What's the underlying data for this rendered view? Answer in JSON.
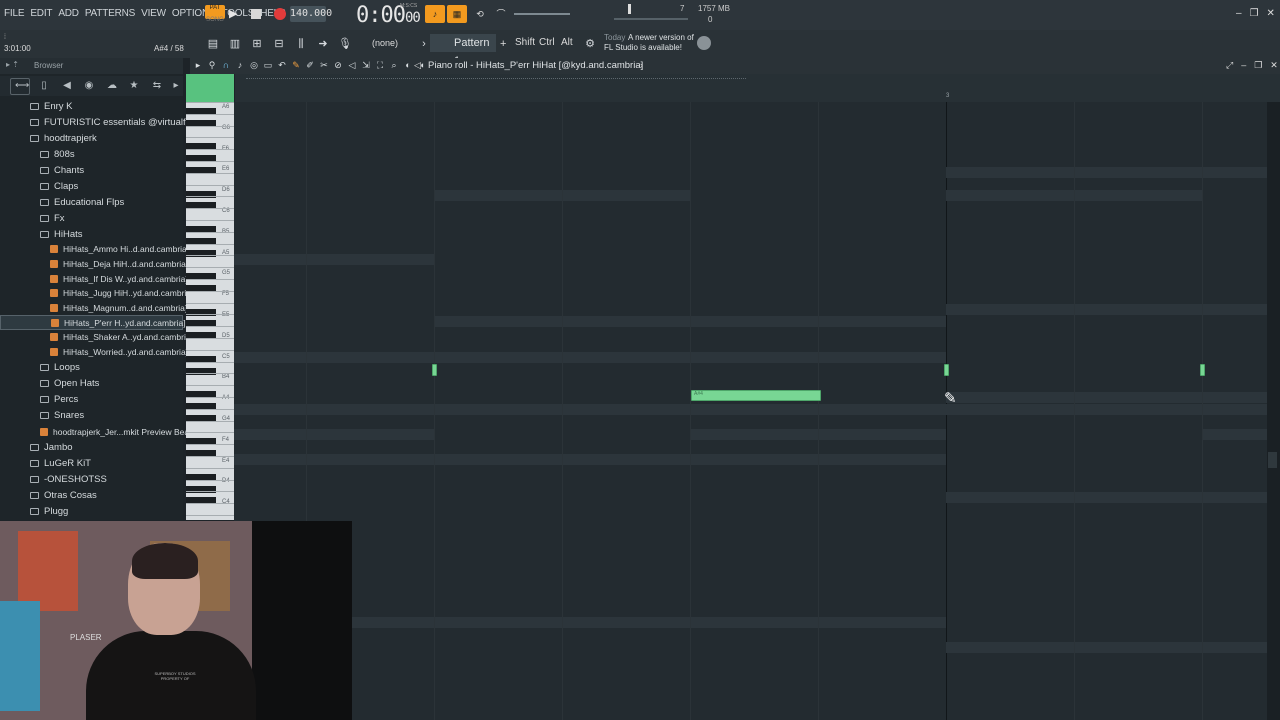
{
  "menu": [
    "FILE",
    "EDIT",
    "ADD",
    "PATTERNS",
    "VIEW",
    "OPTIONS",
    "TOOLS",
    "HELP"
  ],
  "transport": {
    "pat_label": "PAT",
    "song_label": "SONG",
    "tempo": "140.000",
    "time": "0:00",
    "time_sub": "00",
    "time_unit": "M:S:CS"
  },
  "monitor": {
    "cpu": "7",
    "memory": "1757 MB",
    "voices": "0"
  },
  "hint": {
    "line1": "3:01:00",
    "line2": "A#4 / 58"
  },
  "toolbar": {
    "none_label": "(none)",
    "pattern": "Pattern 1",
    "plus": "+",
    "shift": "Shift",
    "ctrl": "Ctrl",
    "alt": "Alt"
  },
  "news": {
    "date": "Today",
    "line1": "A newer version of",
    "line2": "FL Studio is available!"
  },
  "browser": {
    "title": "Browser",
    "items": [
      {
        "label": "Enry K",
        "type": "folder",
        "indent": 0
      },
      {
        "label": "FUTURISTIC essentials @virtualflavor",
        "type": "folder",
        "indent": 0
      },
      {
        "label": "hoodtrapjerk",
        "type": "folder",
        "indent": 0
      },
      {
        "label": "808s",
        "type": "folder",
        "indent": 1
      },
      {
        "label": "Chants",
        "type": "folder",
        "indent": 1
      },
      {
        "label": "Claps",
        "type": "folder",
        "indent": 1
      },
      {
        "label": "Educational Flps",
        "type": "folder",
        "indent": 1
      },
      {
        "label": "Fx",
        "type": "folder",
        "indent": 1
      },
      {
        "label": "HiHats",
        "type": "folder",
        "indent": 1
      },
      {
        "label": "HiHats_Ammo Hi..d.and.cambria]",
        "type": "file",
        "indent": 2
      },
      {
        "label": "HiHats_Deja HiH..d.and.cambria]",
        "type": "file",
        "indent": 2
      },
      {
        "label": "HiHats_If Dis W..yd.and.cambria]",
        "type": "file",
        "indent": 2
      },
      {
        "label": "HiHats_Jugg HiH..yd.and.cambria]",
        "type": "file",
        "indent": 2
      },
      {
        "label": "HiHats_Magnum..d.and.cambria]",
        "type": "file",
        "indent": 2
      },
      {
        "label": "HiHats_P'err H..yd.and.cambria]",
        "type": "file",
        "indent": 2,
        "selected": true
      },
      {
        "label": "HiHats_Shaker A..yd.and.cambria]",
        "type": "file",
        "indent": 2
      },
      {
        "label": "HiHats_Worried..yd.and.cambria]",
        "type": "file",
        "indent": 2
      },
      {
        "label": "Loops",
        "type": "folder",
        "indent": 1
      },
      {
        "label": "Open Hats",
        "type": "folder",
        "indent": 1
      },
      {
        "label": "Percs",
        "type": "folder",
        "indent": 1
      },
      {
        "label": "Snares",
        "type": "folder",
        "indent": 1
      },
      {
        "label": "hoodtrapjerk_Jer...mkit Preview Beats",
        "type": "file",
        "indent": 1
      },
      {
        "label": "Jambo",
        "type": "folder",
        "indent": 0
      },
      {
        "label": "LuGeR KiT",
        "type": "folder",
        "indent": 0
      },
      {
        "label": "-ONESHOTSS",
        "type": "folder",
        "indent": 0
      },
      {
        "label": "Otras Cosas",
        "type": "folder",
        "indent": 0
      },
      {
        "label": "Plugg",
        "type": "folder",
        "indent": 0
      }
    ]
  },
  "piano_roll": {
    "title": "Piano roll - HiHats_P'err HiHat [@kyd.and.cambria]",
    "bar_marker": "3",
    "key_labels": [
      "A6",
      "G6",
      "F6",
      "E6",
      "D6",
      "C6",
      "B5",
      "A5",
      "G5",
      "F5",
      "E5",
      "D5",
      "C5",
      "B4",
      "A4",
      "G4",
      "F4",
      "E4",
      "D4",
      "C4"
    ],
    "note_label": "A#4",
    "colors": {
      "note": "#78d694",
      "accent": "#f39a1f",
      "record": "#e23b3b"
    }
  },
  "webcam": {
    "shirt_text": "SUPERBOY STUDIOS PROPERTY OF",
    "sign_text": "PLASER"
  }
}
